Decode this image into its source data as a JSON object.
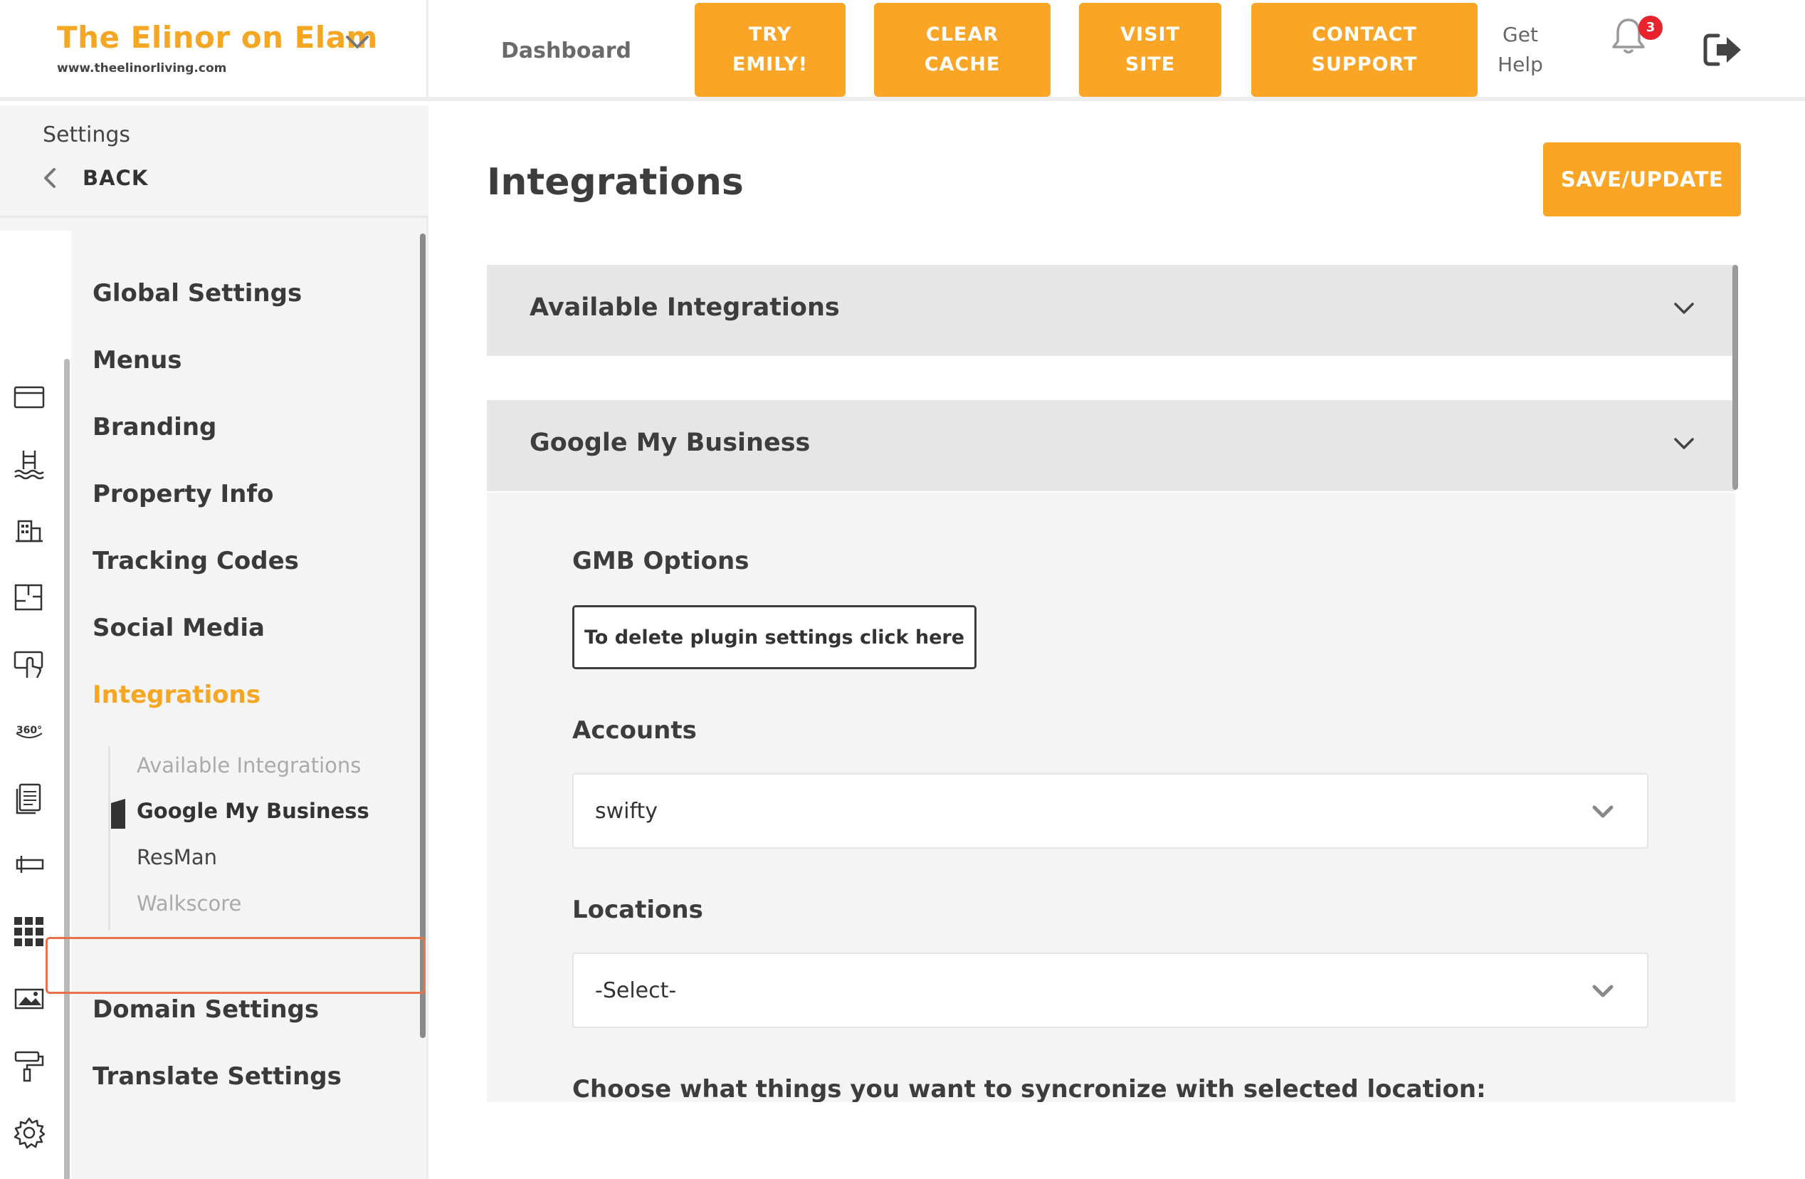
{
  "header": {
    "brand_name": "The Elinor on Elam",
    "brand_url": "www.theelinorliving.com",
    "nav_dashboard": "Dashboard",
    "buttons": [
      {
        "label": "TRY EMILY!"
      },
      {
        "label": "CLEAR CACHE"
      },
      {
        "label": "VISIT SITE"
      },
      {
        "label": "CONTACT SUPPORT"
      }
    ],
    "get_help": "Get Help",
    "notification_count": "3",
    "accent_color": "#faa526"
  },
  "sidebar": {
    "settings_label": "Settings",
    "back_label": "BACK",
    "menu": [
      {
        "label": "Global Settings"
      },
      {
        "label": "Menus"
      },
      {
        "label": "Branding"
      },
      {
        "label": "Property Info"
      },
      {
        "label": "Tracking Codes"
      },
      {
        "label": "Social Media"
      },
      {
        "label": "Integrations"
      },
      {
        "label": "Domain Settings"
      },
      {
        "label": "Translate Settings"
      }
    ],
    "submenu": [
      {
        "label": "Available Integrations"
      },
      {
        "label": "Google My Business"
      },
      {
        "label": "ResMan"
      },
      {
        "label": "Walkscore"
      }
    ],
    "rail_icons": [
      "window-icon",
      "pool-icon",
      "building-icon",
      "floorplan-icon",
      "touch-screen-icon",
      "360-view-icon",
      "document-icon",
      "sign-icon",
      "grid-icon",
      "image-icon",
      "paint-roller-icon",
      "gear-icon",
      "play-icon"
    ]
  },
  "main": {
    "title": "Integrations",
    "save_label": "SAVE/UPDATE",
    "accordions": [
      {
        "title": "Available Integrations"
      },
      {
        "title": "Google My Business"
      }
    ],
    "gmb": {
      "options_label": "GMB Options",
      "delete_button": "To delete plugin settings click here",
      "accounts_label": "Accounts",
      "accounts_value": "swifty",
      "locations_label": "Locations",
      "locations_value": "-Select-",
      "sync_label": "Choose what things you want to syncronize with selected location:"
    }
  }
}
